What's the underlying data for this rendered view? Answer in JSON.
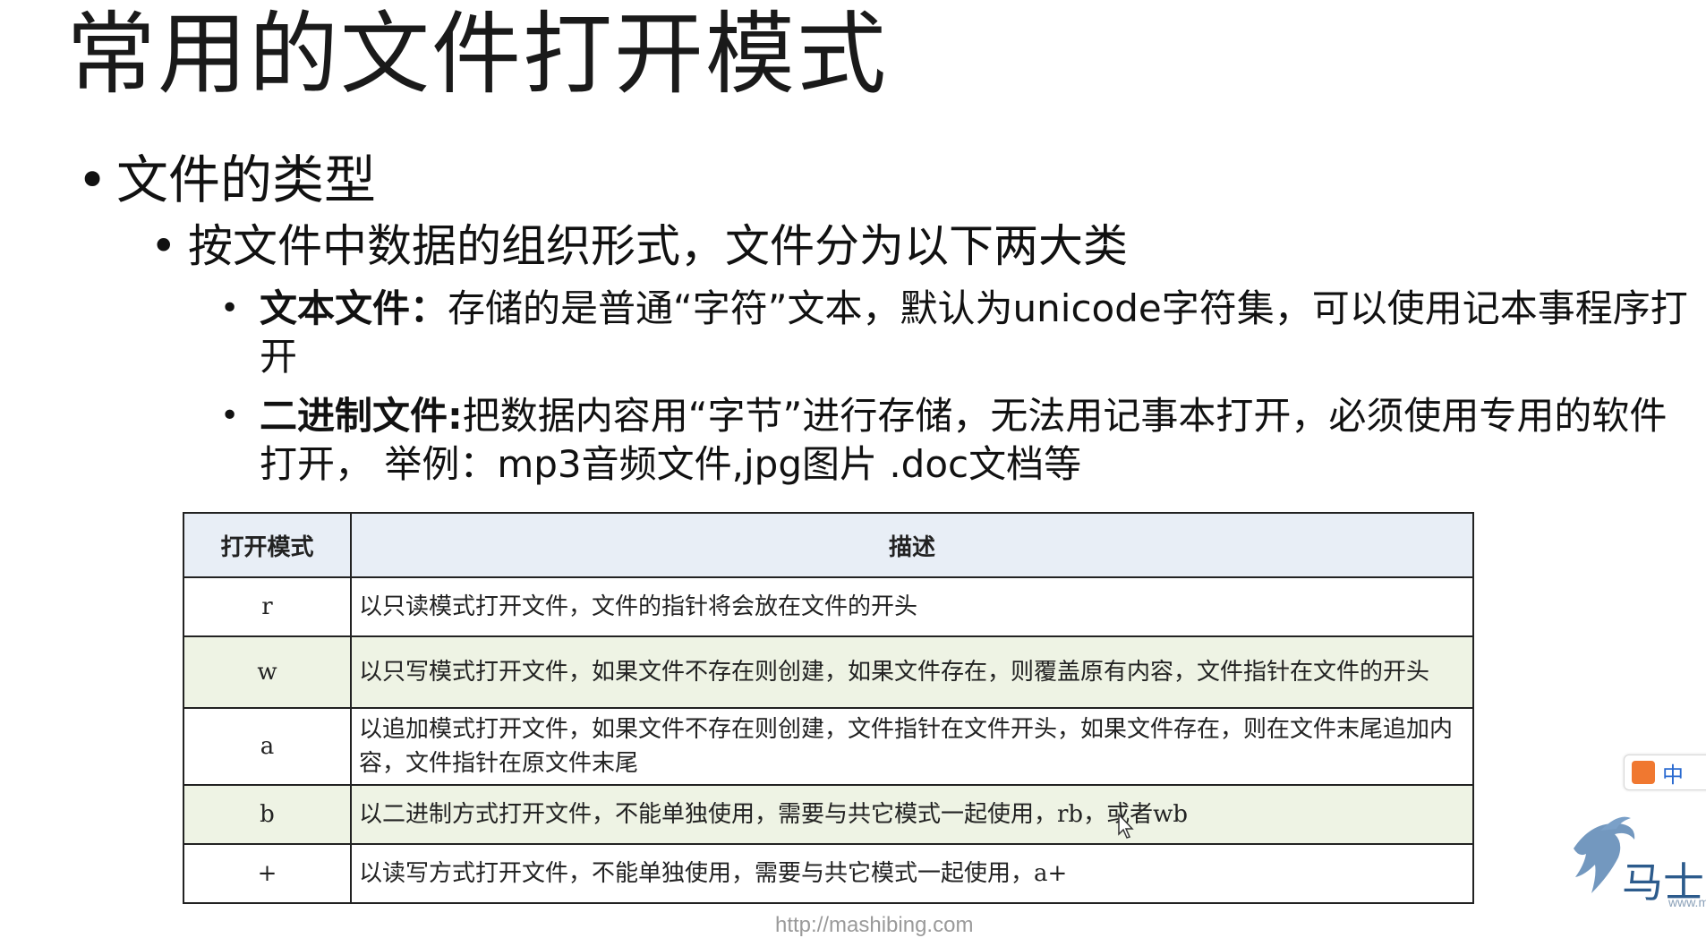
{
  "slide": {
    "title": "常用的文件打开模式",
    "bullet1": "文件的类型",
    "bullet2": "按文件中数据的组织形式，文件分为以下两大类",
    "text_file": {
      "label": "文本文件：",
      "desc": "存储的是普通“字符”文本，默认为unicode字符集，可以使用记本事程序打开"
    },
    "binary_file": {
      "label": "二进制文件:",
      "desc": "把数据内容用“字节”进行存储，无法用记事本打开，必须使用专用的软件打开， 举例：mp3音频文件,jpg图片 .doc文档等"
    }
  },
  "table": {
    "headers": [
      "打开模式",
      "描述"
    ],
    "rows": [
      {
        "mode": "r",
        "desc": "以只读模式打开文件，文件的指针将会放在文件的开头"
      },
      {
        "mode": "w",
        "desc": "以只写模式打开文件，如果文件不存在则创建，如果文件存在，则覆盖原有内容，文件指针在文件的开头"
      },
      {
        "mode": "a",
        "desc": "以追加模式打开文件，如果文件不存在则创建，文件指针在文件开头，如果文件存在，则在文件末尾追加内容，文件指针在原文件末尾"
      },
      {
        "mode": "b",
        "desc": "以二进制方式打开文件，不能单独使用，需要与共它模式一起使用，rb，或者wb"
      },
      {
        "mode": "+",
        "desc": "以读写方式打开文件，不能单独使用，需要与共它模式一起使用，a+"
      }
    ]
  },
  "ime": {
    "label": "中"
  },
  "logo": {
    "text": "马士",
    "url": "www.m"
  },
  "footer": {
    "url": "http://mashibing.com"
  },
  "colors": {
    "header_bg": "#e8eef6",
    "alt_row_bg": "#eef3e4",
    "logo_blue": "#2c5b8c",
    "ime_orange": "#f07830"
  }
}
